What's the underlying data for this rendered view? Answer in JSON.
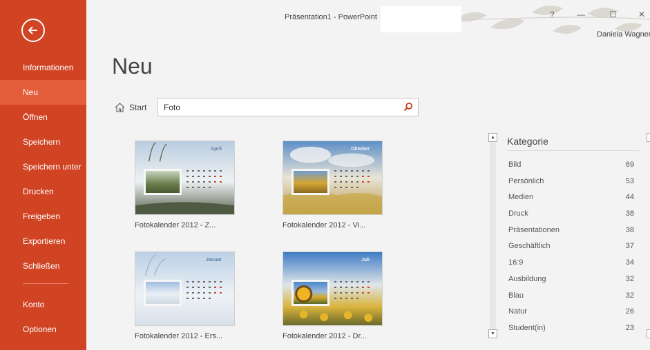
{
  "window": {
    "title": "Präsentation1 - PowerPoint",
    "user": "Daniela Wagner",
    "help_glyph": "?",
    "minimize_glyph": "—",
    "maximize_glyph": "☐",
    "close_glyph": "✕"
  },
  "sidebar": {
    "items": [
      {
        "label": "Informationen"
      },
      {
        "label": "Neu",
        "active": true
      },
      {
        "label": "Öffnen"
      },
      {
        "label": "Speichern"
      },
      {
        "label": "Speichern unter"
      },
      {
        "label": "Drucken"
      },
      {
        "label": "Freigeben"
      },
      {
        "label": "Exportieren"
      },
      {
        "label": "Schließen"
      },
      {
        "label": "Konto"
      },
      {
        "label": "Optionen"
      }
    ]
  },
  "main": {
    "heading": "Neu",
    "home_label": "Start",
    "search_value": "Foto"
  },
  "templates": [
    {
      "label": "Fotokalender 2012 - Z...",
      "month": "April"
    },
    {
      "label": "Fotokalender 2012 - Vi...",
      "month": "Oktober"
    },
    {
      "label": "Fotokalender 2012 - Ers...",
      "month": "Januar"
    },
    {
      "label": "Fotokalender 2012 - Dr...",
      "month": "Juli"
    }
  ],
  "categories": {
    "title": "Kategorie",
    "items": [
      {
        "name": "Bild",
        "count": "69"
      },
      {
        "name": "Persönlich",
        "count": "53"
      },
      {
        "name": "Medien",
        "count": "44"
      },
      {
        "name": "Druck",
        "count": "38"
      },
      {
        "name": "Präsentationen",
        "count": "38"
      },
      {
        "name": "Geschäftlich",
        "count": "37"
      },
      {
        "name": "16:9",
        "count": "34"
      },
      {
        "name": "Ausbildung",
        "count": "32"
      },
      {
        "name": "Blau",
        "count": "32"
      },
      {
        "name": "Natur",
        "count": "26"
      },
      {
        "name": "Student(in)",
        "count": "23"
      }
    ]
  },
  "colors": {
    "accent": "#d04323",
    "accent_active": "#e35d3b",
    "background": "#f3f3f3"
  }
}
